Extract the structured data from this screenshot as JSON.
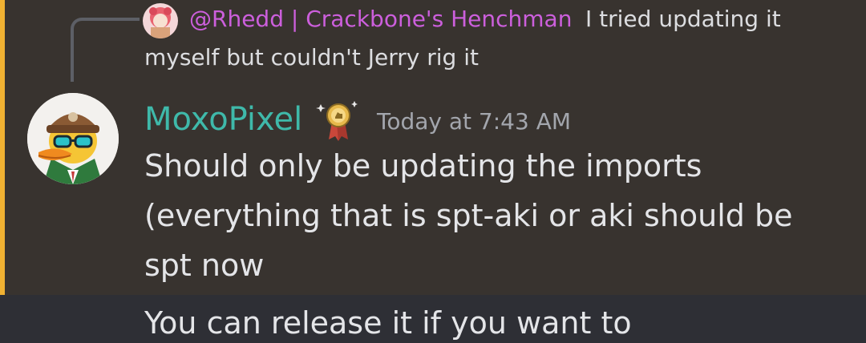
{
  "reply": {
    "mention": "@Rhedd | Crackbone's Henchman",
    "text_line_1": "I tried updating it",
    "text_line_2": "myself but couldn't Jerry rig it"
  },
  "message": {
    "author": "MoxoPixel",
    "timestamp": "Today at 7:43 AM",
    "lines": [
      "Should only be updating the imports",
      "(everything that is spt-aki or aki should be",
      "spt now"
    ]
  },
  "next_message": {
    "text": "You can release it if you want to"
  },
  "colors": {
    "highlight_background": "#38332f",
    "highlight_bar": "#f0b132",
    "mention": "#cc5fdc",
    "author": "#3fb9aa",
    "timestamp": "#a3a6ad",
    "body_text": "#e4e5e8",
    "next_message_background": "#2e2f35"
  },
  "icons": {
    "reply_avatar": "anime-avatar-icon",
    "author_avatar": "duck-with-cap-and-sunglasses-avatar",
    "badge": "award-ribbon-badge-icon"
  }
}
